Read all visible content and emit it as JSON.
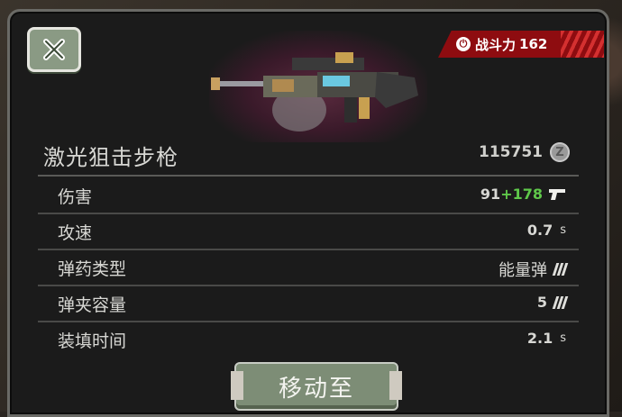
{
  "header": {
    "close_icon": "close-x-icon",
    "power_icon": "power-symbol-icon",
    "power_label": "战斗力",
    "power_value": "162"
  },
  "weapon": {
    "name": "激光狙击步枪",
    "price": "115751",
    "currency_icon": "coin-z-icon"
  },
  "stats": [
    {
      "label": "伤害",
      "value": "91",
      "bonus": "+178",
      "icon": "pistol-icon"
    },
    {
      "label": "攻速",
      "value": "0.7",
      "unit": "s"
    },
    {
      "label": "弹药类型",
      "value": "能量弹",
      "icon": "ammo-icon"
    },
    {
      "label": "弹夹容量",
      "value": "5",
      "icon": "ammo-icon"
    },
    {
      "label": "装填时间",
      "value": "2.1",
      "unit": "s"
    }
  ],
  "action": {
    "move_label": "移动至"
  },
  "colors": {
    "badge_red": "#8e0c10",
    "bonus_green": "#5fc84a",
    "button_green": "#7d8d76"
  }
}
